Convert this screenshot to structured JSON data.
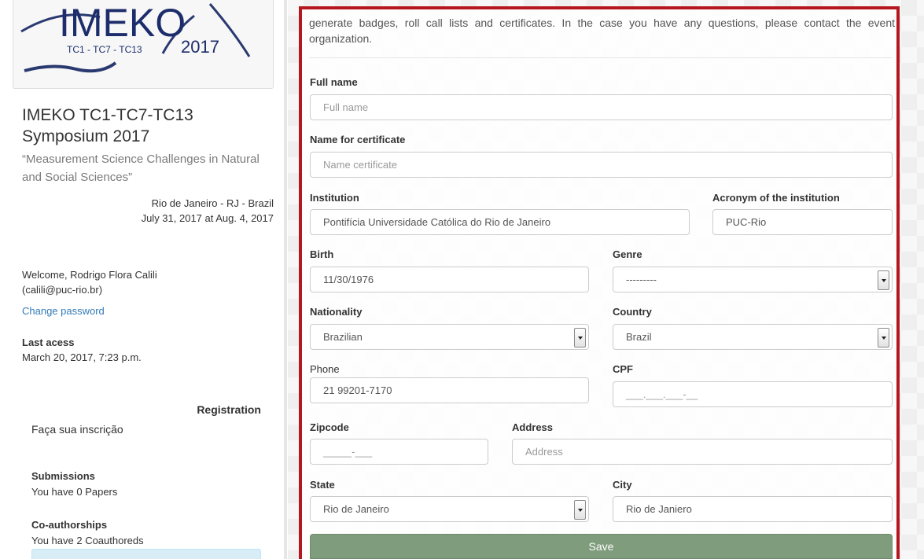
{
  "sidebar": {
    "logo": {
      "main_text": "IMEKO",
      "sub_text": "TC1 - TC7 - TC13",
      "year": "2017"
    },
    "event": {
      "title": "IMEKO TC1-TC7-TC13 Symposium 2017",
      "subtitle": "“Measurement Science Challenges in Natural and Social Sciences”",
      "location": "Rio de Janeiro - RJ - Brazil",
      "dates": "July 31, 2017 at Aug. 4, 2017"
    },
    "user": {
      "welcome": "Welcome, Rodrigo Flora Calili",
      "email": "(calili@puc-rio.br)",
      "change_password": "Change password",
      "last_access_label": "Last acess",
      "last_access_value": "March 20, 2017, 7:23 p.m."
    },
    "registration": {
      "title": "Registration",
      "link": "Faça sua inscrição"
    },
    "submissions": {
      "label": "Submissions",
      "value": "You have 0 Papers"
    },
    "coauthorships": {
      "label": "Co-authorships",
      "value": "You have 2 Coauthoreds"
    }
  },
  "form": {
    "intro": "generate badges, roll call lists and certificates. In the case you have any questions, please contact the event organization.",
    "full_name": {
      "label": "Full name",
      "value": "",
      "placeholder": "Full name"
    },
    "certificate_name": {
      "label": "Name for certificate",
      "value": "",
      "placeholder": "Name certificate"
    },
    "institution": {
      "label": "Institution",
      "value": "Pontifícia Universidade Católica do Rio de Janeiro"
    },
    "acronym": {
      "label": "Acronym of the institution",
      "value": "PUC-Rio"
    },
    "birth": {
      "label": "Birth",
      "value": "11/30/1976"
    },
    "genre": {
      "label": "Genre",
      "value": "---------"
    },
    "nationality": {
      "label": "Nationality",
      "value": "Brazilian"
    },
    "country": {
      "label": "Country",
      "value": "Brazil"
    },
    "phone": {
      "label": "Phone",
      "value": "21 99201-7170"
    },
    "cpf": {
      "label": "CPF",
      "value": "___.___.___-__"
    },
    "zipcode": {
      "label": "Zipcode",
      "value": "_____-___"
    },
    "address": {
      "label": "Address",
      "value": "",
      "placeholder": "Address"
    },
    "state": {
      "label": "State",
      "value": "Rio de Janeiro"
    },
    "city": {
      "label": "City",
      "value": "Rio de Janiero"
    },
    "save_label": "Save"
  },
  "colors": {
    "panel_border": "#b5171e",
    "save_button": "#7f9c7c",
    "link": "#337ab7",
    "info_box": "#d9edf7"
  },
  "icons": {
    "select_arrow": "chevron-down-icon"
  }
}
